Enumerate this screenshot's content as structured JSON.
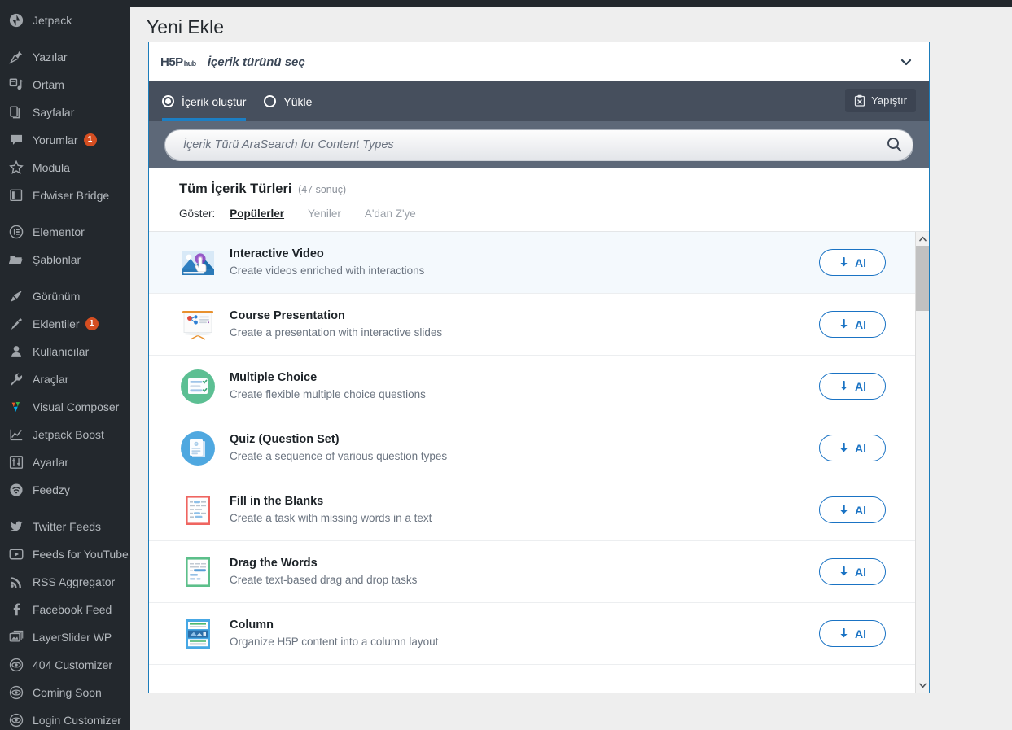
{
  "sidebar": {
    "items": [
      {
        "label": "Jetpack",
        "icon": "jetpack-icon",
        "badge": null,
        "group": 0
      },
      {
        "label": "Yazılar",
        "icon": "pin-icon",
        "badge": null,
        "group": 1
      },
      {
        "label": "Ortam",
        "icon": "media-icon",
        "badge": null,
        "group": 1
      },
      {
        "label": "Sayfalar",
        "icon": "pages-icon",
        "badge": null,
        "group": 1
      },
      {
        "label": "Yorumlar",
        "icon": "comments-icon",
        "badge": "1",
        "group": 1
      },
      {
        "label": "Modula",
        "icon": "modula-icon",
        "badge": null,
        "group": 1
      },
      {
        "label": "Edwiser Bridge",
        "icon": "book-icon",
        "badge": null,
        "group": 1
      },
      {
        "label": "Elementor",
        "icon": "elementor-icon",
        "badge": null,
        "group": 2
      },
      {
        "label": "Şablonlar",
        "icon": "folder-icon",
        "badge": null,
        "group": 2
      },
      {
        "label": "Görünüm",
        "icon": "appearance-brush-icon",
        "badge": null,
        "group": 3
      },
      {
        "label": "Eklentiler",
        "icon": "plugin-icon",
        "badge": "1",
        "group": 3
      },
      {
        "label": "Kullanıcılar",
        "icon": "users-icon",
        "badge": null,
        "group": 3
      },
      {
        "label": "Araçlar",
        "icon": "tools-wrench-icon",
        "badge": null,
        "group": 3
      },
      {
        "label": "Visual Composer",
        "icon": "visual-composer-icon",
        "badge": null,
        "group": 3
      },
      {
        "label": "Jetpack Boost",
        "icon": "chart-line-icon",
        "badge": null,
        "group": 3
      },
      {
        "label": "Ayarlar",
        "icon": "settings-sliders-icon",
        "badge": null,
        "group": 3
      },
      {
        "label": "Feedzy",
        "icon": "feedzy-wifi-icon",
        "badge": null,
        "group": 3
      },
      {
        "label": "Twitter Feeds",
        "icon": "twitter-icon",
        "badge": null,
        "group": 4
      },
      {
        "label": "Feeds for YouTube",
        "icon": "youtube-icon",
        "badge": null,
        "group": 4
      },
      {
        "label": "RSS Aggregator",
        "icon": "rss-icon",
        "badge": null,
        "group": 4
      },
      {
        "label": "Facebook Feed",
        "icon": "facebook-icon",
        "badge": null,
        "group": 4
      },
      {
        "label": "LayerSlider WP",
        "icon": "layerslider-images-icon",
        "badge": null,
        "group": 4
      },
      {
        "label": "404 Customizer",
        "icon": "customizer-icon",
        "badge": null,
        "group": 4
      },
      {
        "label": "Coming Soon",
        "icon": "customizer-icon",
        "badge": null,
        "group": 4
      },
      {
        "label": "Login Customizer",
        "icon": "customizer-icon",
        "badge": null,
        "group": 4
      }
    ]
  },
  "page": {
    "title": "Yeni Ekle"
  },
  "hub": {
    "logo_main": "H5P",
    "logo_sub": "hub",
    "title": "İçerik türünü seç",
    "chevron_icon": "chevron-down-icon",
    "tabs": [
      {
        "label": "İçerik oluştur",
        "selected": true
      },
      {
        "label": "Yükle",
        "selected": false
      }
    ],
    "paste_button": {
      "label": "Yapıştır",
      "icon": "clipboard-x-icon"
    },
    "search": {
      "placeholder": "İçerik Türü AraSearch for Content Types",
      "value": "",
      "icon": "search-icon"
    },
    "filters": {
      "heading": "Tüm İçerik Türleri",
      "count": "(47 sonuç)",
      "show_label": "Göster:",
      "options": [
        {
          "label": "Popülerler",
          "active": true
        },
        {
          "label": "Yeniler",
          "active": false
        },
        {
          "label": "A'dan Z'ye",
          "active": false
        }
      ]
    },
    "get_button_label": "Al",
    "get_button_icon": "download-arrow-icon",
    "content_types": [
      {
        "title": "Interactive Video",
        "description": "Create videos enriched with interactions",
        "icon": "interactive-video-icon",
        "highlight": true
      },
      {
        "title": "Course Presentation",
        "description": "Create a presentation with interactive slides",
        "icon": "course-presentation-icon",
        "highlight": false
      },
      {
        "title": "Multiple Choice",
        "description": "Create flexible multiple choice questions",
        "icon": "multiple-choice-icon",
        "highlight": false
      },
      {
        "title": "Quiz (Question Set)",
        "description": "Create a sequence of various question types",
        "icon": "quiz-question-set-icon",
        "highlight": false
      },
      {
        "title": "Fill in the Blanks",
        "description": "Create a task with missing words in a text",
        "icon": "fill-in-the-blanks-icon",
        "highlight": false
      },
      {
        "title": "Drag the Words",
        "description": "Create text-based drag and drop tasks",
        "icon": "drag-the-words-icon",
        "highlight": false
      },
      {
        "title": "Column",
        "description": "Organize H5P content into a column layout",
        "icon": "column-icon",
        "highlight": false
      }
    ]
  },
  "colors": {
    "sidebar_bg": "#23282d",
    "accent_blue": "#1a73c4",
    "panel_border": "#1b7cba",
    "tabbar_bg": "#464f5d",
    "searchbar_bg": "#5d6878",
    "badge_red": "#d54e21",
    "page_bg": "#eeeeee"
  }
}
